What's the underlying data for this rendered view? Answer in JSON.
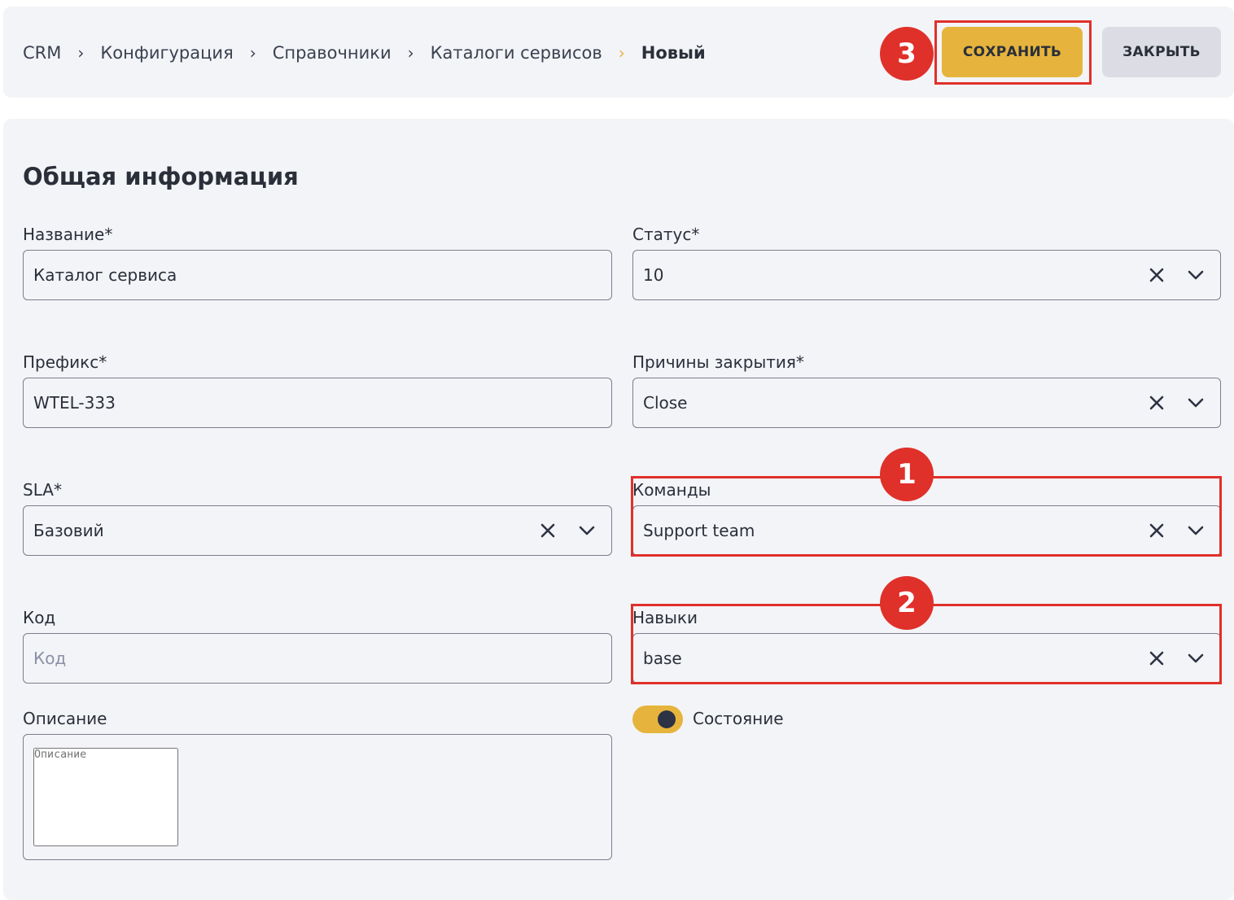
{
  "breadcrumb": [
    {
      "label": "CRM"
    },
    {
      "label": "Конфигурация"
    },
    {
      "label": "Справочники"
    },
    {
      "label": "Каталоги сервисов"
    },
    {
      "label": "Новый"
    }
  ],
  "toolbar": {
    "save_label": "СОХРАНИТЬ",
    "close_label": "ЗАКРЫТЬ"
  },
  "section": {
    "title": "Общая информация"
  },
  "fields": {
    "name": {
      "label": "Название*",
      "value": "Каталог сервиса"
    },
    "status": {
      "label": "Статус*",
      "value": "10"
    },
    "prefix": {
      "label": "Префикс*",
      "value": "WTEL-333"
    },
    "close_reasons": {
      "label": "Причины закрытия*",
      "value": "Close"
    },
    "sla": {
      "label": "SLA*",
      "value": "Базовий"
    },
    "teams": {
      "label": "Команды",
      "value": "Support team"
    },
    "code": {
      "label": "Код",
      "placeholder": "Код"
    },
    "skills": {
      "label": "Навыки",
      "value": "base"
    },
    "description": {
      "label": "Описание",
      "placeholder": "Описание"
    },
    "state": {
      "label": "Состояние",
      "enabled": true
    }
  },
  "annotations": {
    "badge_1": "1",
    "badge_2": "2",
    "badge_3": "3"
  },
  "colors": {
    "accent": "#e6b43c",
    "highlight": "#e0302a",
    "background": "#f3f4f7"
  }
}
